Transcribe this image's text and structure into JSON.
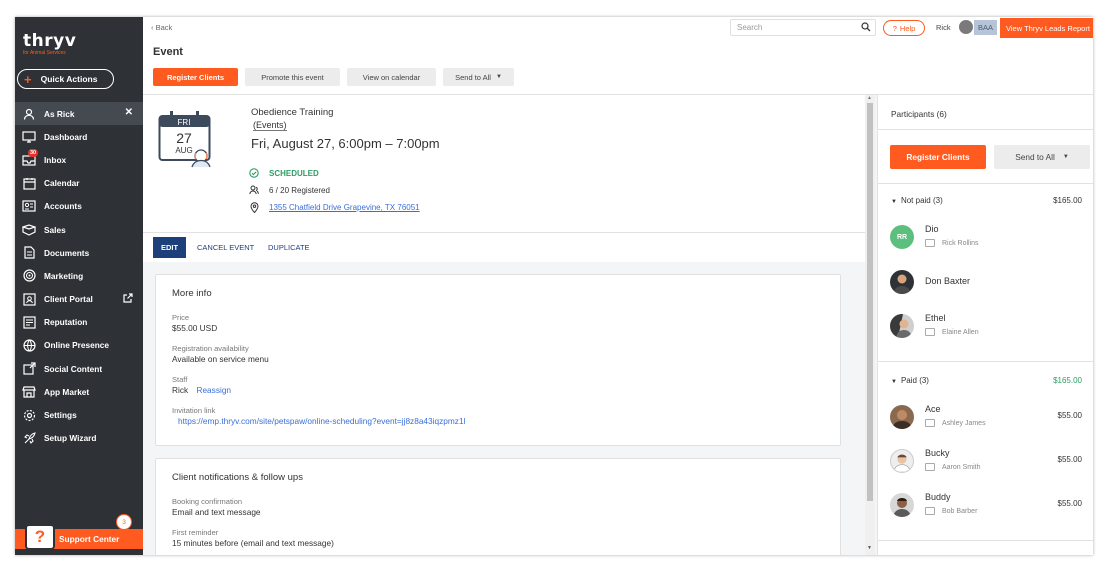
{
  "brand": {
    "name": "thryv",
    "subtitle": "for Animal Services"
  },
  "sidebar": {
    "quick_actions": "Quick Actions",
    "items": [
      {
        "label": "As Rick",
        "icon": "user-icon"
      },
      {
        "label": "Dashboard",
        "icon": "dashboard-icon"
      },
      {
        "label": "Inbox",
        "icon": "inbox-icon",
        "badge": "30"
      },
      {
        "label": "Calendar",
        "icon": "calendar-icon"
      },
      {
        "label": "Accounts",
        "icon": "accounts-icon"
      },
      {
        "label": "Sales",
        "icon": "sales-icon"
      },
      {
        "label": "Documents",
        "icon": "documents-icon"
      },
      {
        "label": "Marketing",
        "icon": "marketing-icon"
      },
      {
        "label": "Client Portal",
        "icon": "client-portal-icon"
      },
      {
        "label": "Reputation",
        "icon": "reputation-icon"
      },
      {
        "label": "Online Presence",
        "icon": "online-presence-icon"
      },
      {
        "label": "Social Content",
        "icon": "social-content-icon"
      },
      {
        "label": "App Market",
        "icon": "app-market-icon"
      },
      {
        "label": "Settings",
        "icon": "settings-icon"
      },
      {
        "label": "Setup Wizard",
        "icon": "setup-wizard-icon"
      }
    ],
    "support_center": "Support Center",
    "support_count": "3"
  },
  "topbar": {
    "back": "Back",
    "search_placeholder": "Search",
    "help": "Help",
    "user_name": "Rick",
    "user_initials": "BAA",
    "leads_button": "View Thryv Leads Report"
  },
  "header": {
    "title": "Event",
    "register_clients": "Register Clients",
    "promote": "Promote this event",
    "view_calendar": "View on calendar",
    "send_to_all": "Send to All"
  },
  "event": {
    "calendar_day": "FRI",
    "calendar_date": "27",
    "calendar_month": "AUG",
    "name": "Obedience Training",
    "category": "(Events)",
    "datetime": "Fri, August 27, 6:00pm – 7:00pm",
    "status": "SCHEDULED",
    "registered": "6 / 20 Registered",
    "address": "1355 Chatfield Drive Grapevine, TX 76051"
  },
  "tabs": {
    "edit": "EDIT",
    "cancel": "CANCEL EVENT",
    "duplicate": "DUPLICATE"
  },
  "more_info": {
    "title": "More info",
    "price_label": "Price",
    "price_value": "$55.00 USD",
    "availability_label": "Registration availability",
    "availability_value": "Available on service menu",
    "staff_label": "Staff",
    "staff_value": "Rick",
    "reassign": "Reassign",
    "invitation_label": "Invitation link",
    "invitation_value": "https://emp.thryv.com/site/petspaw/online-scheduling?event=jj8z8a43iqzpmz1l"
  },
  "notifications": {
    "title": "Client notifications & follow ups",
    "booking_label": "Booking confirmation",
    "booking_value": "Email and text message",
    "first_reminder_label": "First reminder",
    "first_reminder_value": "15 minutes before (email and text message)"
  },
  "participants": {
    "title": "Participants (6)",
    "register_clients": "Register Clients",
    "send_to_all": "Send to All",
    "not_paid": {
      "label": "Not paid (3)",
      "total": "$165.00",
      "items": [
        {
          "name": "Dio",
          "owner": "Rick Rollins",
          "initials": "RR",
          "amount": ""
        },
        {
          "name": "Don Baxter",
          "owner": "",
          "initials": "",
          "amount": ""
        },
        {
          "name": "Ethel",
          "owner": "Elaine Allen",
          "initials": "",
          "amount": ""
        }
      ]
    },
    "paid": {
      "label": "Paid (3)",
      "total": "$165.00",
      "items": [
        {
          "name": "Ace",
          "owner": "Ashley James",
          "amount": "$55.00"
        },
        {
          "name": "Bucky",
          "owner": "Aaron Smith",
          "amount": "$55.00"
        },
        {
          "name": "Buddy",
          "owner": "Bob Barber",
          "amount": "$55.00"
        }
      ]
    }
  },
  "colors": {
    "accent": "#ff5a1f",
    "sidebar": "#2e3236",
    "navy": "#1d3f7a",
    "success": "#2e9e63",
    "link": "#3a6fd8"
  }
}
